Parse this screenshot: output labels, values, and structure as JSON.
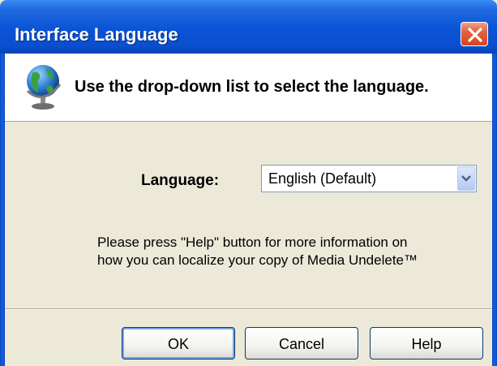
{
  "window": {
    "title": "Interface Language"
  },
  "header": {
    "instruction": "Use the drop-down list to select the language."
  },
  "language": {
    "label": "Language:",
    "selected": "English (Default)"
  },
  "info": {
    "line1": "Please press \"Help\" button for more information on",
    "line2": "how you can localize your copy of Media Undelete™"
  },
  "buttons": {
    "ok": "OK",
    "cancel": "Cancel",
    "help": "Help"
  },
  "icons": {
    "close": "close-icon",
    "globe": "globe-icon",
    "dropdown": "chevron-down-icon"
  },
  "colors": {
    "titlebar": "#0b53d6",
    "dialog_bg": "#ece9d8",
    "close_button": "#d3451f"
  }
}
